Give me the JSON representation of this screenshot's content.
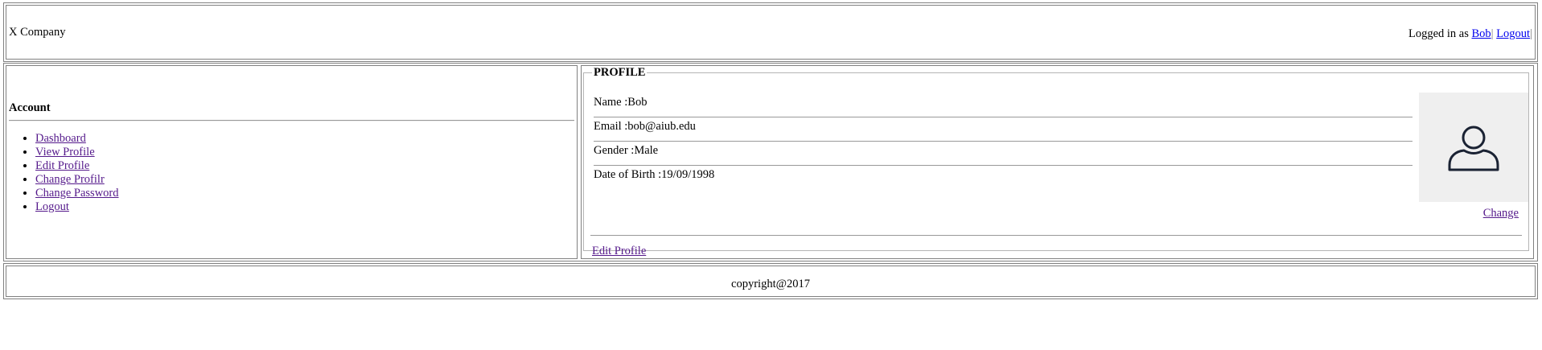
{
  "header": {
    "company": "X Company",
    "logged_in_prefix": "Logged in as ",
    "user_link": "Bob",
    "separator": "|",
    "logout_link": "Logout",
    "trailing_separator": "|"
  },
  "sidebar": {
    "title": "Account",
    "items": [
      {
        "label": "Dashboard"
      },
      {
        "label": "View Profile"
      },
      {
        "label": "Edit Profile"
      },
      {
        "label": "Change Profilr"
      },
      {
        "label": "Change Password"
      },
      {
        "label": "Logout"
      }
    ]
  },
  "profile": {
    "legend": "PROFILE",
    "fields": [
      {
        "label": "Name :",
        "value": "Bob"
      },
      {
        "label": "Email :",
        "value": "bob@aiub.edu"
      },
      {
        "label": "Gender :",
        "value": "Male"
      },
      {
        "label": "Date of Birth :",
        "value": "19/09/1998"
      }
    ],
    "avatar_icon": "user-silhouette-icon",
    "change_link": "Change",
    "edit_link": "Edit Profile"
  },
  "footer": {
    "copyright": "copyright@2017"
  },
  "colors": {
    "visited_link": "#551a8b",
    "link": "#0000ee",
    "border": "#808080",
    "avatar_bg": "#efefef"
  }
}
